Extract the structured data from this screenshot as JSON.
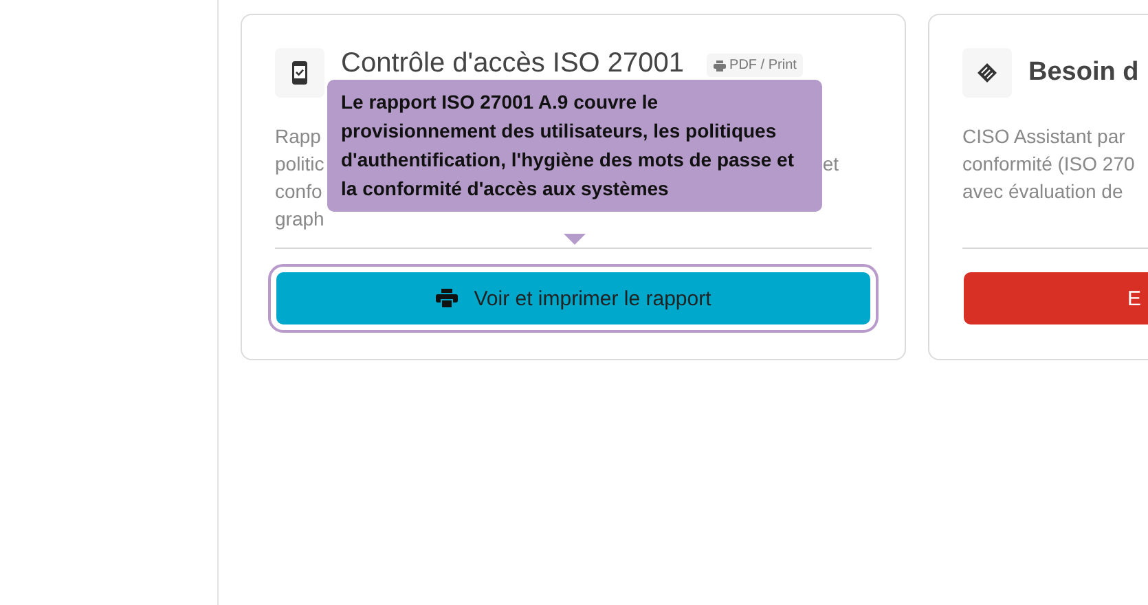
{
  "cards": [
    {
      "kind": "report",
      "title": "Contrôle d'accès ISO 27001",
      "badge": "PDF / Print",
      "description_lines": [
        {
          "left": "Rapp"
        },
        {
          "left": "politic",
          "right": "et"
        },
        {
          "left": "confo"
        },
        {
          "left": "graph"
        }
      ],
      "button": "Voir et imprimer le rapport",
      "focused": true,
      "tooltip": "Le rapport ISO 27001 A.9 couvre le provisionnement des utilisateurs, les politiques d'authentification, l'hygiène des mots de passe et la conformité d'accès aux systèmes"
    },
    {
      "kind": "help",
      "title": "Besoin d",
      "description_lines": [
        {
          "left": "CISO Assistant par"
        },
        {
          "left": "conformité (ISO 270"
        },
        {
          "left": "avec évaluation de"
        }
      ],
      "button": "E"
    }
  ]
}
